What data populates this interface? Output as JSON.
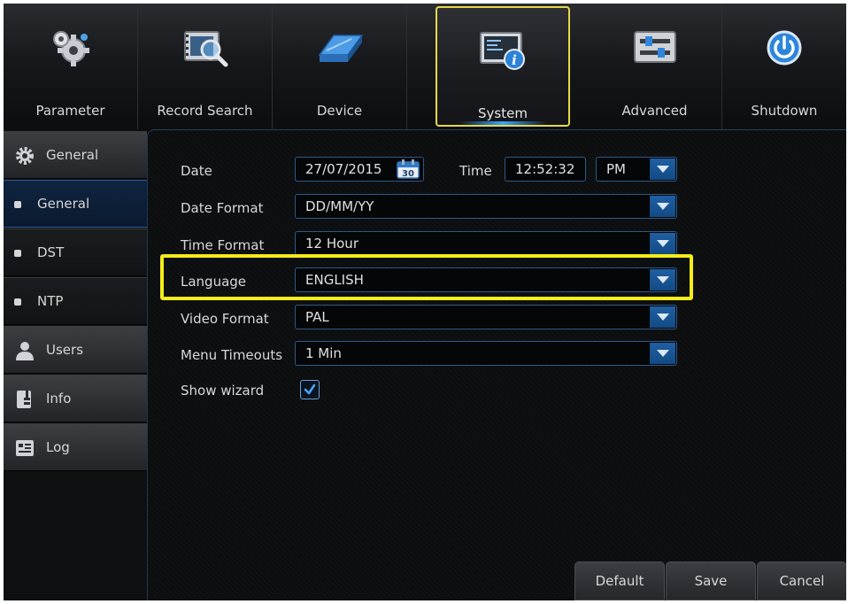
{
  "nav": [
    {
      "label": "Parameter",
      "icon": "gears-icon"
    },
    {
      "label": "Record Search",
      "icon": "film-search-icon"
    },
    {
      "label": "Device",
      "icon": "hard-drive-icon"
    },
    {
      "label": "System",
      "icon": "monitor-info-icon",
      "active": true
    },
    {
      "label": "Advanced",
      "icon": "sliders-icon"
    },
    {
      "label": "Shutdown",
      "icon": "power-icon"
    }
  ],
  "sidebar": {
    "general_group": "General",
    "items": [
      "General",
      "DST",
      "NTP"
    ],
    "users": "Users",
    "info": "Info",
    "log": "Log"
  },
  "form": {
    "date_label": "Date",
    "date_value": "27/07/2015",
    "calendar_day": "30",
    "time_label": "Time",
    "time_value": "12:52:32",
    "ampm_value": "PM",
    "date_format_label": "Date Format",
    "date_format_value": "DD/MM/YY",
    "time_format_label": "Time Format",
    "time_format_value": "12 Hour",
    "language_label": "Language",
    "language_value": "ENGLISH",
    "video_format_label": "Video Format",
    "video_format_value": "PAL",
    "menu_timeouts_label": "Menu Timeouts",
    "menu_timeouts_value": "1 Min",
    "show_wizard_label": "Show wizard",
    "show_wizard_checked": true
  },
  "buttons": {
    "default": "Default",
    "save": "Save",
    "cancel": "Cancel"
  },
  "colors": {
    "highlight": "#f4ec1a",
    "accent_blue": "#1f5fa3",
    "active_tab_border": "#e6d84a"
  }
}
